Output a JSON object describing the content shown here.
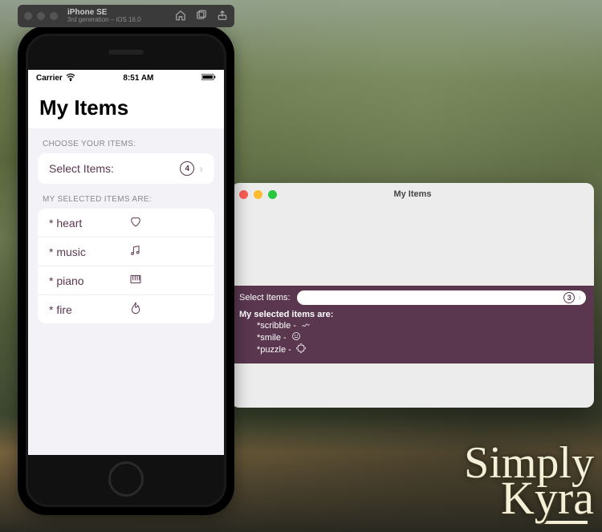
{
  "simulator_toolbar": {
    "device": "iPhone SE",
    "subtitle": "3rd generation – iOS 16.0"
  },
  "phone": {
    "status": {
      "carrier": "Carrier",
      "time": "8:51 AM"
    },
    "title": "My Items",
    "section_choose": "CHOOSE YOUR ITEMS:",
    "select_label": "Select Items:",
    "select_count": "4",
    "section_selected": "MY SELECTED ITEMS ARE:",
    "items": [
      {
        "name": "* heart",
        "icon": "heart-icon"
      },
      {
        "name": "* music",
        "icon": "music-icon"
      },
      {
        "name": "* piano",
        "icon": "piano-icon"
      },
      {
        "name": "* fire",
        "icon": "flame-icon"
      }
    ]
  },
  "mac": {
    "title": "My Items",
    "select_label": "Select Items:",
    "select_count": "3",
    "selected_header": "My selected items are:",
    "items": [
      {
        "name": "*scribble -",
        "icon": "scribble-icon"
      },
      {
        "name": "*smile -",
        "icon": "smile-icon"
      },
      {
        "name": "*puzzle -",
        "icon": "puzzle-icon"
      }
    ]
  },
  "watermark": {
    "l1": "Simply",
    "l2": "Kyra"
  }
}
